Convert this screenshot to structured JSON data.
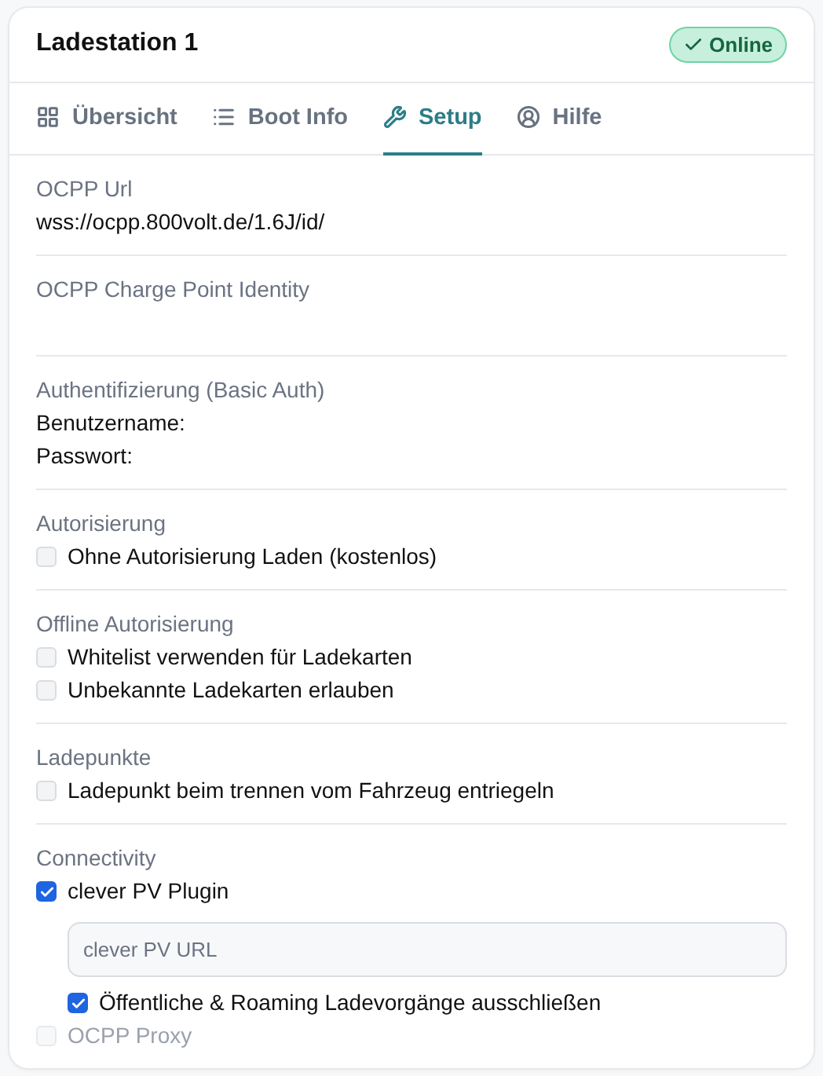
{
  "header": {
    "title": "Ladestation 1",
    "status": {
      "label": "Online",
      "kind": "online"
    }
  },
  "tabs": [
    {
      "label": "Übersicht",
      "selected": false
    },
    {
      "label": "Boot Info",
      "selected": false
    },
    {
      "label": "Setup",
      "selected": true
    },
    {
      "label": "Hilfe",
      "selected": false
    }
  ],
  "sections": [
    {
      "title": "OCPP Url",
      "items": [
        {
          "kind": "value",
          "text": "wss://ocpp.800volt.de/1.6J/id/"
        }
      ]
    },
    {
      "title": "OCPP Charge Point Identity",
      "items": [
        {
          "kind": "empty"
        }
      ]
    },
    {
      "title": "Authentifizierung (Basic Auth)",
      "items": [
        {
          "kind": "value",
          "text": "Benutzername:"
        },
        {
          "kind": "value",
          "text": "Passwort:"
        }
      ]
    },
    {
      "title": "Autorisierung",
      "items": [
        {
          "kind": "checkbox",
          "label": "Ohne Autorisierung Laden (kostenlos)",
          "checked": false,
          "disabled": false
        }
      ]
    },
    {
      "title": "Offline Autorisierung",
      "items": [
        {
          "kind": "checkbox",
          "label": "Whitelist verwenden für Ladekarten",
          "checked": false,
          "disabled": false
        },
        {
          "kind": "checkbox",
          "label": "Unbekannte Ladekarten erlauben",
          "checked": false,
          "disabled": false
        }
      ]
    },
    {
      "title": "Ladepunkte",
      "items": [
        {
          "kind": "checkbox",
          "label": "Ladepunkt beim trennen vom Fahrzeug entriegeln",
          "checked": false,
          "disabled": false
        }
      ]
    },
    {
      "title": "Connectivity",
      "items": [
        {
          "kind": "checkbox",
          "label": "clever PV Plugin",
          "checked": true,
          "disabled": false,
          "children": [
            {
              "kind": "input",
              "placeholder": "clever PV URL"
            },
            {
              "kind": "checkbox",
              "label": "Öffentliche & Roaming Ladevorgänge ausschließen",
              "checked": true,
              "disabled": false
            }
          ]
        },
        {
          "kind": "checkbox",
          "label": "OCPP Proxy",
          "checked": false,
          "disabled": true
        }
      ]
    }
  ]
}
